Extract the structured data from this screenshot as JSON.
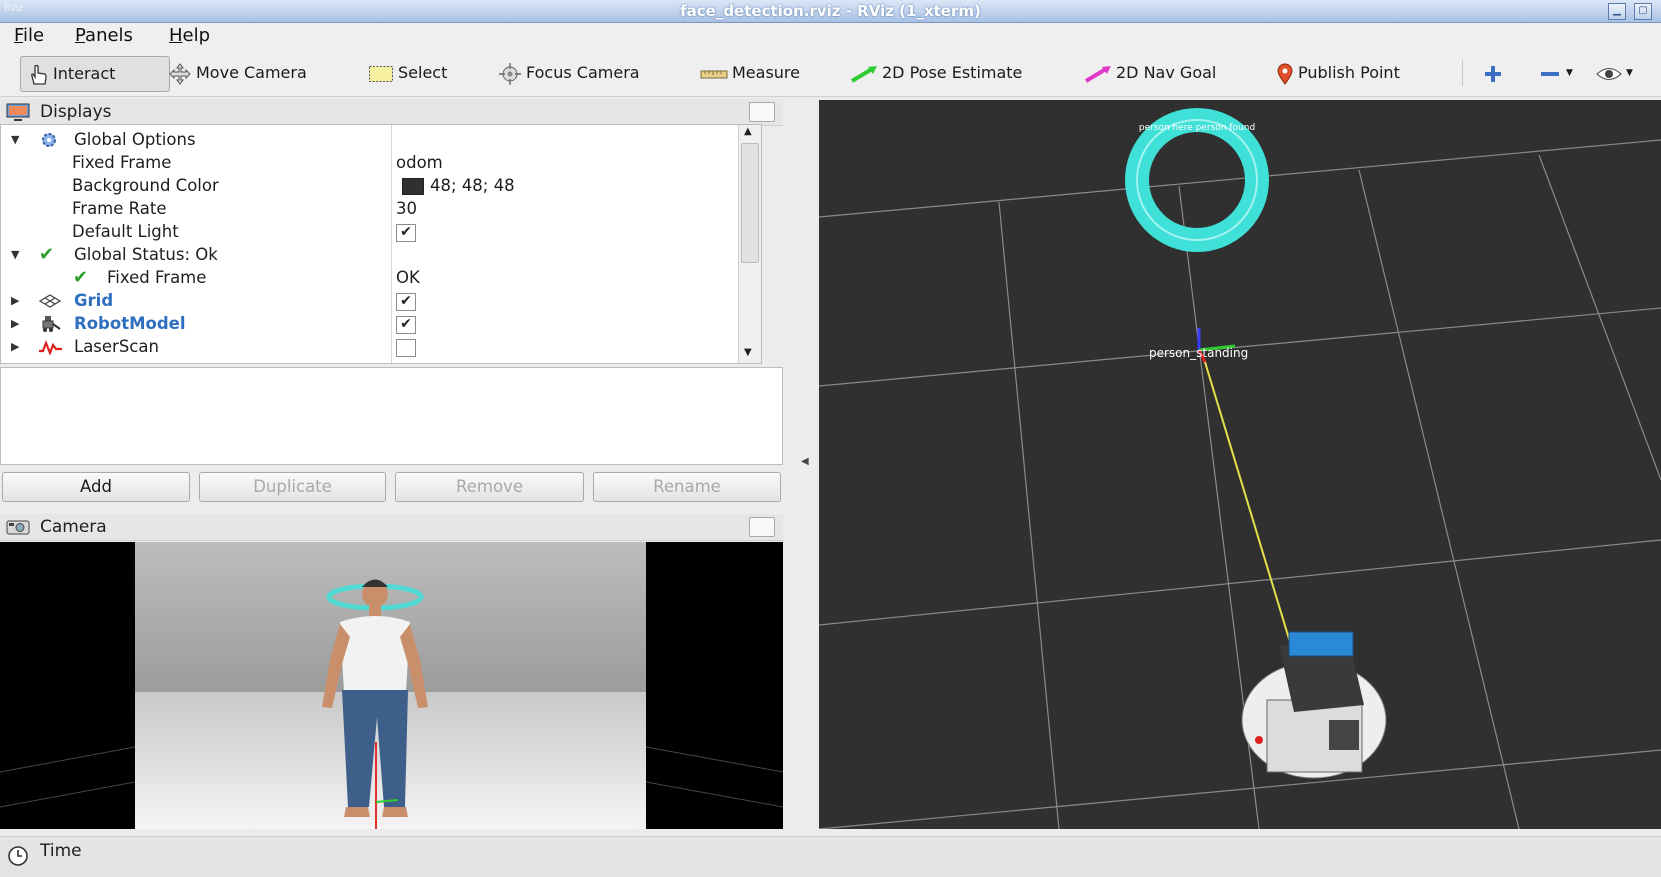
{
  "window": {
    "title": "face_detection.rviz - RViz (1_xterm)",
    "app_icon_label": "RViz"
  },
  "menu": [
    "File",
    "Panels",
    "Help"
  ],
  "toolbar": {
    "interact": "Interact",
    "move_camera": "Move Camera",
    "select": "Select",
    "focus_camera": "Focus Camera",
    "measure": "Measure",
    "pose_estimate": "2D Pose Estimate",
    "nav_goal": "2D Nav Goal",
    "publish_point": "Publish Point"
  },
  "displays": {
    "title": "Displays",
    "global_options": "Global Options",
    "fixed_frame_label": "Fixed Frame",
    "fixed_frame_value": "odom",
    "bg_color_label": "Background Color",
    "bg_color_value": "48; 48; 48",
    "bg_color_swatch": "#303030",
    "frame_rate_label": "Frame Rate",
    "frame_rate_value": "30",
    "default_light_label": "Default Light",
    "global_status": "Global Status: Ok",
    "status_fixed_frame_label": "Fixed Frame",
    "status_fixed_frame_value": "OK",
    "grid": "Grid",
    "robot_model": "RobotModel",
    "laser_scan": "LaserScan",
    "checks": {
      "default_light": true,
      "grid": true,
      "robot_model": true,
      "laser_scan": false
    }
  },
  "buttons": {
    "add": "Add",
    "duplicate": "Duplicate",
    "remove": "Remove",
    "rename": "Rename"
  },
  "camera_panel": {
    "title": "Camera"
  },
  "view3d": {
    "frame_label": "person_standing",
    "marker_text": "person here person found"
  },
  "time_panel": {
    "title": "Time"
  },
  "colors": {
    "accent": "#2f6fbf",
    "marker": "#3fe0d8",
    "grid_bg": "#303030",
    "check_green": "#2a9d2a"
  }
}
